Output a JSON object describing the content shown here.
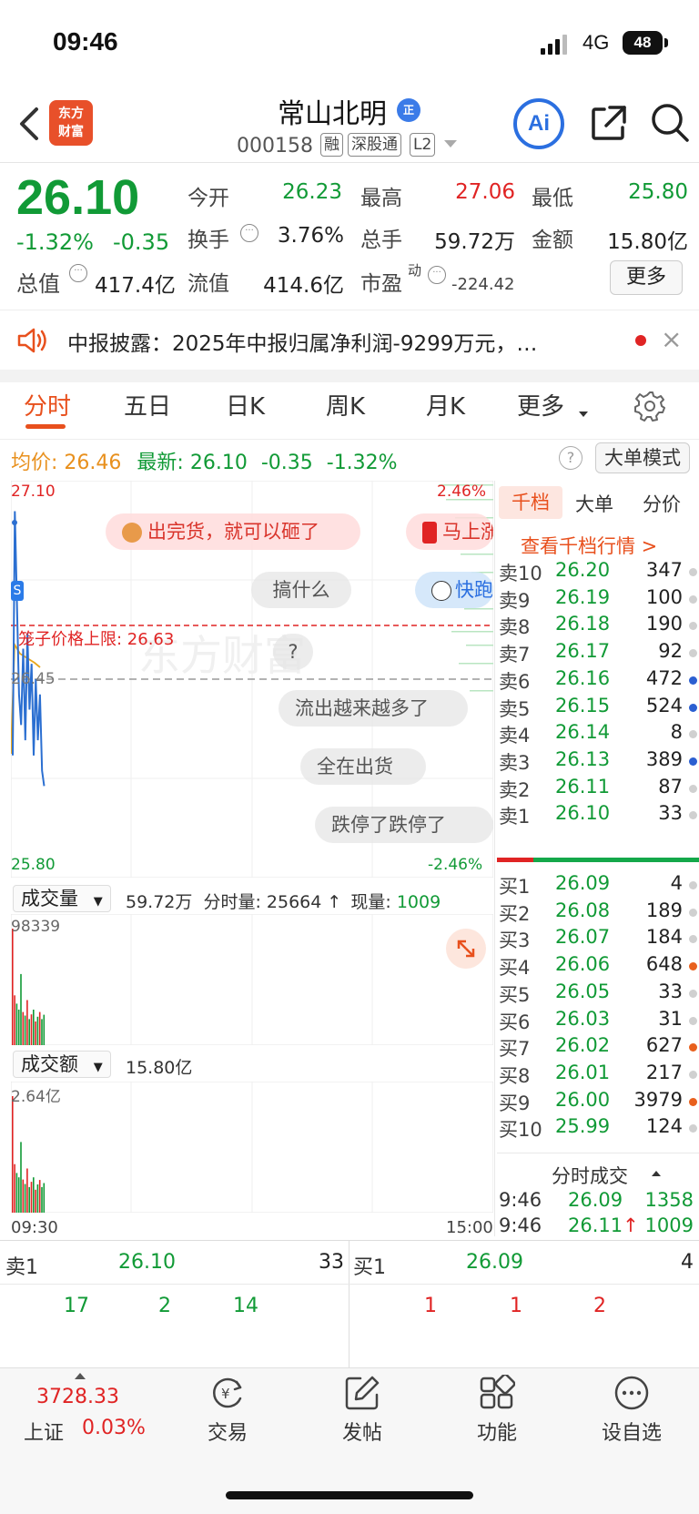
{
  "status_bar": {
    "time": "09:46",
    "network": "4G",
    "battery": "48"
  },
  "header": {
    "logo_text_1": "东方",
    "logo_text_2": "财富",
    "stock_name": "常山北明",
    "verified_badge": "正",
    "stock_code": "000158",
    "tags": [
      "融",
      "深股通",
      "L2"
    ],
    "ai_label": "Ai"
  },
  "quote": {
    "price": "26.10",
    "change_pct": "-1.32%",
    "change_amt": "-0.35",
    "open_label": "今开",
    "open": "26.23",
    "high_label": "最高",
    "high": "27.06",
    "low_label": "最低",
    "low": "25.80",
    "turnover_label": "换手",
    "turnover": "3.76%",
    "volume_label": "总手",
    "volume": "59.72万",
    "amount_label": "金额",
    "amount": "15.80亿",
    "mktcap_label": "总值",
    "mktcap": "417.4亿",
    "float_label": "流值",
    "float": "414.6亿",
    "pe_label": "市盈",
    "pe_sup": "动",
    "pe": "-224.42",
    "more_label": "更多"
  },
  "notice": {
    "text": "中报披露：2025年中报归属净利润-9299万元，…",
    "close": "×"
  },
  "tabs": [
    "分时",
    "五日",
    "日K",
    "周K",
    "月K",
    "更多"
  ],
  "avg_line": {
    "avg_label": "均价:",
    "avg": "26.46",
    "latest_label": "最新:",
    "latest": "26.10",
    "chg": "-0.35",
    "pct": "-1.32%",
    "help": "?",
    "big_order_label": "大单模式"
  },
  "chart": {
    "price_high": "27.10",
    "price_low": "25.80",
    "pct_high": "2.46%",
    "pct_low": "-2.46%",
    "avg_mid": "26.45",
    "limit_label": "笼子价格上限: 26.63",
    "time_start": "09:30",
    "time_end": "15:00",
    "watermark": "东方财富"
  },
  "comments": [
    "出完货，就可以砸了",
    "马上涨",
    "搞什么",
    "快跑",
    "?",
    "流出越来越多了",
    "全在出货",
    "跌停了跌停了"
  ],
  "volume_panel": {
    "selector": "成交量",
    "total": "59.72万",
    "detail_label": "分时量:",
    "detail": "25664",
    "arrow": "↑",
    "now_label": "现量:",
    "now": "1009",
    "max": "98339"
  },
  "amount_panel": {
    "selector": "成交额",
    "total": "15.80亿",
    "max": "2.64亿"
  },
  "chart_data": {
    "type": "line",
    "title": "",
    "series": [
      {
        "name": "",
        "y": [
          26.2,
          27.0,
          26.7,
          26.4,
          26.3,
          26.55,
          26.25,
          26.6,
          26.35,
          26.5,
          26.2,
          26.45,
          26.25,
          26.4,
          26.15,
          26.1
        ]
      }
    ],
    "ylim": [
      25.8,
      27.1
    ],
    "volume": [
      98339,
      42000,
      35000,
      30000,
      60000,
      28000,
      25000,
      38000,
      22000,
      26000,
      30000,
      20000,
      24000,
      28000,
      22000,
      25664
    ],
    "amount": [
      2.64,
      1.1,
      0.9,
      0.8,
      1.6,
      0.75,
      0.65,
      1.0,
      0.58,
      0.7,
      0.8,
      0.52,
      0.64,
      0.74,
      0.58,
      0.67
    ]
  },
  "order_book": {
    "tabs": [
      "千档",
      "大单",
      "分价"
    ],
    "depth_link": "查看千档行情 >",
    "asks": [
      {
        "label": "卖10",
        "price": "26.20",
        "vol": "347",
        "dot": "#d0d0d0"
      },
      {
        "label": "卖9",
        "price": "26.19",
        "vol": "100",
        "dot": "#d0d0d0"
      },
      {
        "label": "卖8",
        "price": "26.18",
        "vol": "190",
        "dot": "#d0d0d0"
      },
      {
        "label": "卖7",
        "price": "26.17",
        "vol": "92",
        "dot": "#d0d0d0"
      },
      {
        "label": "卖6",
        "price": "26.16",
        "vol": "472",
        "dot": "#2b5fd1"
      },
      {
        "label": "卖5",
        "price": "26.15",
        "vol": "524",
        "dot": "#2b5fd1"
      },
      {
        "label": "卖4",
        "price": "26.14",
        "vol": "8",
        "dot": "#d0d0d0"
      },
      {
        "label": "卖3",
        "price": "26.13",
        "vol": "389",
        "dot": "#2b5fd1"
      },
      {
        "label": "卖2",
        "price": "26.11",
        "vol": "87",
        "dot": "#d0d0d0"
      },
      {
        "label": "卖1",
        "price": "26.10",
        "vol": "33",
        "dot": "#d0d0d0"
      }
    ],
    "bids": [
      {
        "label": "买1",
        "price": "26.09",
        "vol": "4",
        "dot": "#d0d0d0"
      },
      {
        "label": "买2",
        "price": "26.08",
        "vol": "189",
        "dot": "#d0d0d0"
      },
      {
        "label": "买3",
        "price": "26.07",
        "vol": "184",
        "dot": "#d0d0d0"
      },
      {
        "label": "买4",
        "price": "26.06",
        "vol": "648",
        "dot": "#e8601d"
      },
      {
        "label": "买5",
        "price": "26.05",
        "vol": "33",
        "dot": "#d0d0d0"
      },
      {
        "label": "买6",
        "price": "26.03",
        "vol": "31",
        "dot": "#d0d0d0"
      },
      {
        "label": "买7",
        "price": "26.02",
        "vol": "627",
        "dot": "#e8601d"
      },
      {
        "label": "买8",
        "price": "26.01",
        "vol": "217",
        "dot": "#d0d0d0"
      },
      {
        "label": "买9",
        "price": "26.00",
        "vol": "3979",
        "dot": "#e8601d"
      },
      {
        "label": "买10",
        "price": "25.99",
        "vol": "124",
        "dot": "#d0d0d0"
      }
    ],
    "ticks_title": "分时成交",
    "ticks": [
      {
        "time": "9:46",
        "price": "26.09",
        "arrow": "",
        "vol": "1358"
      },
      {
        "time": "9:46",
        "price": "26.11",
        "arrow": "↑",
        "vol": "1009"
      }
    ]
  },
  "level1": {
    "ask_label": "卖1",
    "ask_price": "26.10",
    "ask_vol": "33",
    "bid_label": "买1",
    "bid_price": "26.09",
    "bid_vol": "4",
    "ask_queue": [
      "17",
      "2",
      "14"
    ],
    "bid_queue": [
      "1",
      "1",
      "2"
    ]
  },
  "footer": {
    "index_value": "3728.33",
    "index_name": "上证",
    "index_change": "0.03%",
    "nav": [
      "交易",
      "发帖",
      "功能",
      "设自选"
    ]
  },
  "colors": {
    "up": "#e02424",
    "down": "#119a36",
    "accent": "#e8501d",
    "price_line": "#2b6fd1",
    "avg_line": "#e8a71d"
  }
}
